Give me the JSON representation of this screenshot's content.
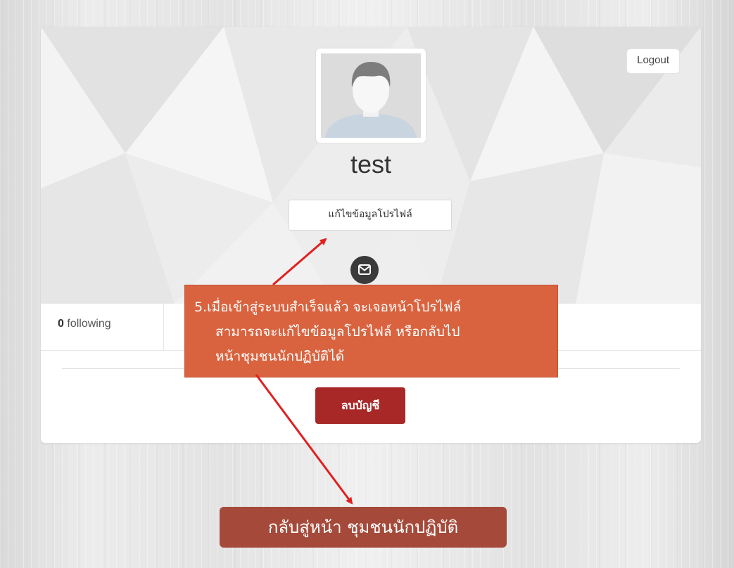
{
  "header": {
    "logout_label": "Logout"
  },
  "profile": {
    "username": "test",
    "edit_profile_label": "แก้ไขข้อมูลโปรไฟล์",
    "avatar_icon": "default-user-avatar",
    "message_icon": "envelope-icon"
  },
  "stats": {
    "following_count": "0",
    "following_label": "following"
  },
  "actions": {
    "delete_account_label": "ลบบัญชี"
  },
  "annotation": {
    "lines": [
      "5.เมื่อเข้าสู่ระบบสำเร็จแล้ว จะเจอหน้าโปรไฟล์",
      "สามารถจะแก้ไขข้อมูลโปรไฟล์ หรือกลับไป",
      "หน้าชุมชนนักปฏิบัติได้"
    ],
    "bottom_button_label": "กลับสู่หน้า ชุมชนนักปฏิบัติ"
  },
  "colors": {
    "delete_button": "#a82828",
    "callout_bg": "#d9633f",
    "bottom_button": "#a54a3a",
    "arrow": "#e02020"
  }
}
